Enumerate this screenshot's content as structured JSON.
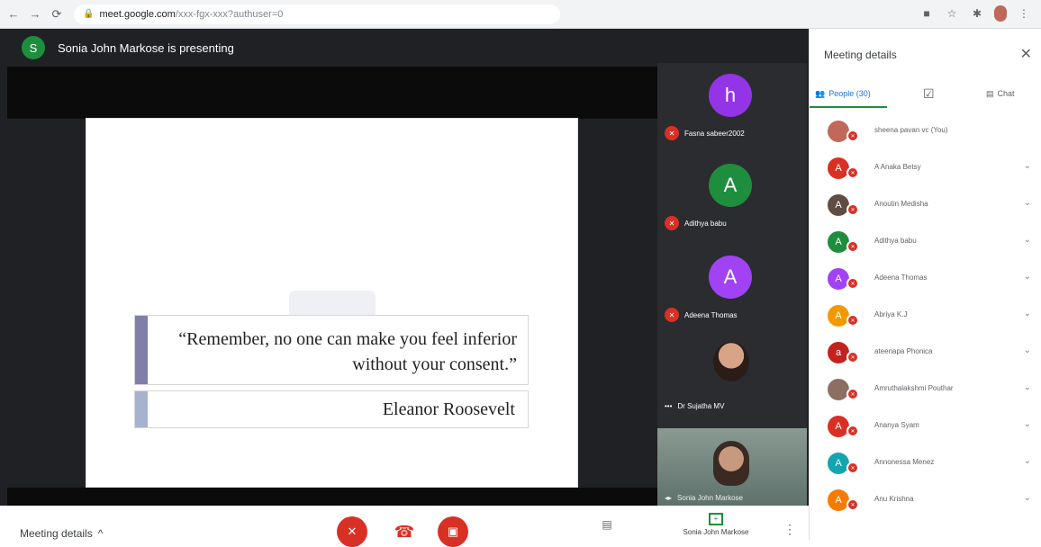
{
  "browser": {
    "url_host": "meet.google.com",
    "url_path": "/xxx-fgx-xxx?authuser=0"
  },
  "stage": {
    "presenter_initial": "S",
    "presenter_text": "Sonia John Markose is presenting",
    "quote": "“Remember, no one can make you feel inferior without your consent.”",
    "author": "Eleanor Roosevelt"
  },
  "tiles": [
    {
      "initial": "h",
      "name": "Fasna sabeer2002",
      "color": "#9334e6"
    },
    {
      "initial": "A",
      "name": "Adithya babu",
      "color": "#1e8e3e"
    },
    {
      "initial": "A",
      "name": "Adeena Thomas",
      "color": "#a142f4"
    },
    {
      "initial": "",
      "name": "Dr Sujatha MV",
      "color": ""
    }
  ],
  "self_tile": {
    "name": "Sonia John Markose"
  },
  "controls": {
    "meeting_details": "Meeting details",
    "present_label": "Sonia John Markose"
  },
  "panel": {
    "title": "Meeting details",
    "tab_people": "People (30)",
    "tab_chat": "Chat",
    "people": [
      {
        "initial": "",
        "name": "sheena pavan vc (You)",
        "color": "#c0685a"
      },
      {
        "initial": "A",
        "name": "A Anaka Betsy",
        "color": "#d93025"
      },
      {
        "initial": "A",
        "name": "Anoutin Medisha",
        "color": "#5f4c43"
      },
      {
        "initial": "A",
        "name": "Adithya babu",
        "color": "#1e8e3e"
      },
      {
        "initial": "A",
        "name": "Adeena Thomas",
        "color": "#a142f4"
      },
      {
        "initial": "A",
        "name": "Abriya K.J",
        "color": "#f29900"
      },
      {
        "initial": "a",
        "name": "ateenapa Phonica",
        "color": "#c5221f"
      },
      {
        "initial": "",
        "name": "Amruthalakshmi Pouthar",
        "color": "#8d6e63"
      },
      {
        "initial": "A",
        "name": "Ananya Syam",
        "color": "#d93025"
      },
      {
        "initial": "A",
        "name": "Annonessa Menez",
        "color": "#12a4af"
      },
      {
        "initial": "A",
        "name": "Anu Krishna",
        "color": "#f57c00"
      }
    ]
  }
}
